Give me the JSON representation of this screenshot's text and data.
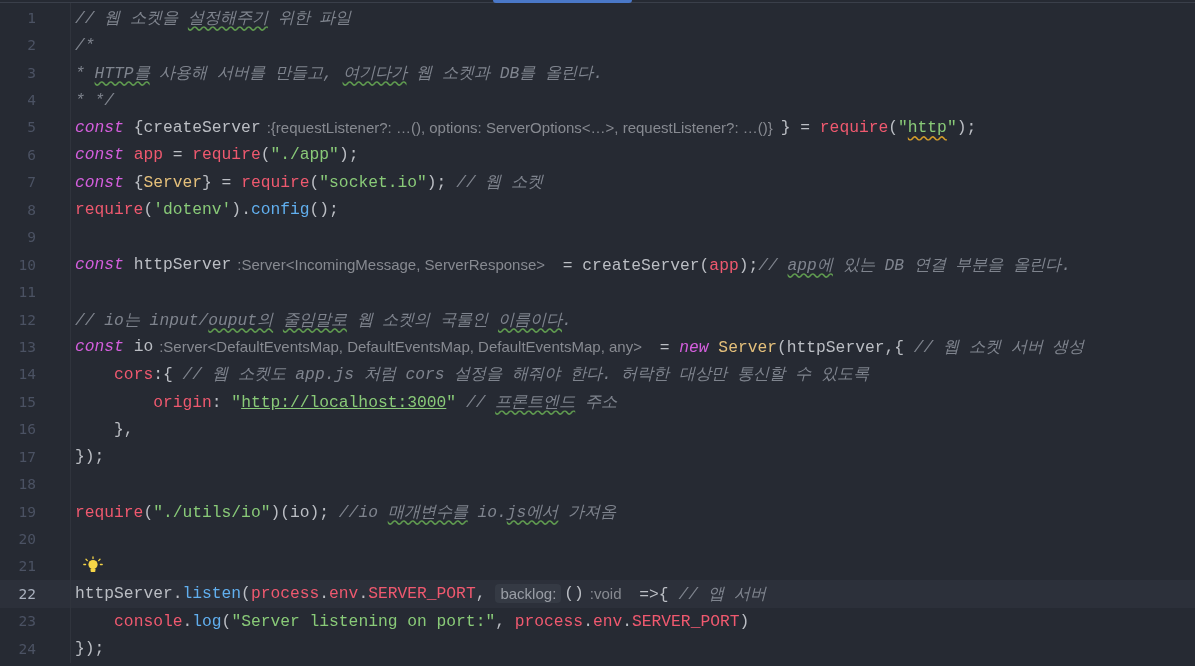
{
  "editor": {
    "lines": [
      {
        "number": "1",
        "current": false,
        "bulb": false,
        "tokens": [
          {
            "kind": "comment",
            "text": "// 웹 소켓을 "
          },
          {
            "kind": "comment-flagged",
            "text": "설정해주기"
          },
          {
            "kind": "comment",
            "text": " 위한 파일"
          }
        ]
      },
      {
        "number": "2",
        "current": false,
        "bulb": false,
        "tokens": [
          {
            "kind": "comment",
            "text": "/*"
          }
        ]
      },
      {
        "number": "3",
        "current": false,
        "bulb": false,
        "tokens": [
          {
            "kind": "comment",
            "text": "* "
          },
          {
            "kind": "comment-flagged",
            "text": "HTTP를"
          },
          {
            "kind": "comment",
            "text": " 사용해 서버를 만들고, "
          },
          {
            "kind": "comment-flagged",
            "text": "여기다가"
          },
          {
            "kind": "comment",
            "text": " 웹 소켓과 DB를 올린다."
          }
        ]
      },
      {
        "number": "4",
        "current": false,
        "bulb": false,
        "tokens": [
          {
            "kind": "comment",
            "text": "* */"
          }
        ]
      },
      {
        "number": "5",
        "current": false,
        "bulb": false,
        "tokens": [
          {
            "kind": "keyword",
            "text": "const"
          },
          {
            "kind": "plain",
            "text": " {createServer"
          },
          {
            "kind": "hint",
            "text": ":{requestListener?: …(), options: ServerOptions<…>, requestListener?: …()}"
          },
          {
            "kind": "plain",
            "text": "} = "
          },
          {
            "kind": "variable",
            "text": "require"
          },
          {
            "kind": "plain",
            "text": "("
          },
          {
            "kind": "string",
            "text": "\""
          },
          {
            "kind": "string-flagged",
            "text": "http"
          },
          {
            "kind": "string",
            "text": "\""
          },
          {
            "kind": "plain",
            "text": ");"
          }
        ]
      },
      {
        "number": "6",
        "current": false,
        "bulb": false,
        "tokens": [
          {
            "kind": "keyword",
            "text": "const"
          },
          {
            "kind": "variable",
            "text": " app"
          },
          {
            "kind": "plain",
            "text": " = "
          },
          {
            "kind": "variable",
            "text": "require"
          },
          {
            "kind": "plain",
            "text": "("
          },
          {
            "kind": "string",
            "text": "\"./app\""
          },
          {
            "kind": "plain",
            "text": ");"
          }
        ]
      },
      {
        "number": "7",
        "current": false,
        "bulb": false,
        "tokens": [
          {
            "kind": "keyword",
            "text": "const"
          },
          {
            "kind": "plain",
            "text": " {"
          },
          {
            "kind": "class",
            "text": "Server"
          },
          {
            "kind": "plain",
            "text": "} = "
          },
          {
            "kind": "variable",
            "text": "require"
          },
          {
            "kind": "plain",
            "text": "("
          },
          {
            "kind": "string",
            "text": "\"socket.io\""
          },
          {
            "kind": "plain",
            "text": "); "
          },
          {
            "kind": "comment",
            "text": "// 웹 소켓"
          }
        ]
      },
      {
        "number": "8",
        "current": false,
        "bulb": false,
        "tokens": [
          {
            "kind": "variable",
            "text": "require"
          },
          {
            "kind": "plain",
            "text": "("
          },
          {
            "kind": "string",
            "text": "'dotenv'"
          },
          {
            "kind": "plain",
            "text": ")."
          },
          {
            "kind": "function",
            "text": "config"
          },
          {
            "kind": "plain",
            "text": "();"
          }
        ]
      },
      {
        "number": "9",
        "current": false,
        "bulb": false
      },
      {
        "number": "10",
        "current": false,
        "bulb": false,
        "tokens": [
          {
            "kind": "keyword",
            "text": "const"
          },
          {
            "kind": "plain",
            "text": " httpServer"
          },
          {
            "kind": "hint",
            "text": ":Server<IncomingMessage, ServerResponse>"
          },
          {
            "kind": "plain",
            "text": " = createServer("
          },
          {
            "kind": "variable",
            "text": "app"
          },
          {
            "kind": "plain",
            "text": ");"
          },
          {
            "kind": "comment",
            "text": "// "
          },
          {
            "kind": "comment-flagged",
            "text": "app에"
          },
          {
            "kind": "comment",
            "text": " 있는 DB 연결 부분을 올린다."
          }
        ]
      },
      {
        "number": "11",
        "current": false,
        "bulb": false
      },
      {
        "number": "12",
        "current": false,
        "bulb": false,
        "tokens": [
          {
            "kind": "comment",
            "text": "// io는 input/"
          },
          {
            "kind": "comment-flagged",
            "text": "ouput의"
          },
          {
            "kind": "comment-flagged",
            "text": " 줄임말로"
          },
          {
            "kind": "comment",
            "text": " 웹 소켓의 국룰인 "
          },
          {
            "kind": "comment-flagged",
            "text": "이름이다"
          },
          {
            "kind": "comment",
            "text": "."
          }
        ]
      },
      {
        "number": "13",
        "current": false,
        "bulb": false,
        "tokens": [
          {
            "kind": "keyword",
            "text": "const"
          },
          {
            "kind": "plain",
            "text": " io"
          },
          {
            "kind": "hint",
            "text": ":Server<DefaultEventsMap, DefaultEventsMap, DefaultEventsMap, any>"
          },
          {
            "kind": "plain",
            "text": " = "
          },
          {
            "kind": "keyword",
            "text": "new "
          },
          {
            "kind": "class",
            "text": "Server"
          },
          {
            "kind": "plain",
            "text": "(httpServer,{ "
          },
          {
            "kind": "comment",
            "text": "// 웹 소켓 서버 생성"
          }
        ]
      },
      {
        "number": "14",
        "current": false,
        "bulb": false,
        "tokens": [
          {
            "kind": "variable",
            "text": "    cors"
          },
          {
            "kind": "plain",
            "text": ":{ "
          },
          {
            "kind": "comment",
            "text": "// 웹 소켓도 app.js 처럼 cors 설정을 해줘야 한다. 허락한 대상만 통신할 수 있도록"
          }
        ]
      },
      {
        "number": "15",
        "current": false,
        "bulb": false,
        "tokens": [
          {
            "kind": "variable",
            "text": "        origin"
          },
          {
            "kind": "plain",
            "text": ": "
          },
          {
            "kind": "string",
            "text": "\""
          },
          {
            "kind": "url",
            "text": "http://localhost:3000"
          },
          {
            "kind": "string",
            "text": "\""
          },
          {
            "kind": "comment",
            "text": " // "
          },
          {
            "kind": "comment-flagged",
            "text": "프론트엔드"
          },
          {
            "kind": "comment",
            "text": " 주소"
          }
        ]
      },
      {
        "number": "16",
        "current": false,
        "bulb": false,
        "tokens": [
          {
            "kind": "plain",
            "text": "    },"
          }
        ]
      },
      {
        "number": "17",
        "current": false,
        "bulb": false,
        "tokens": [
          {
            "kind": "plain",
            "text": "});"
          }
        ]
      },
      {
        "number": "18",
        "current": false,
        "bulb": false
      },
      {
        "number": "19",
        "current": false,
        "bulb": false,
        "tokens": [
          {
            "kind": "variable",
            "text": "require"
          },
          {
            "kind": "plain",
            "text": "("
          },
          {
            "kind": "string",
            "text": "\"./utils/io\""
          },
          {
            "kind": "plain",
            "text": ")(io); "
          },
          {
            "kind": "comment",
            "text": "//io "
          },
          {
            "kind": "comment-flagged",
            "text": "매개변수를"
          },
          {
            "kind": "comment",
            "text": " io."
          },
          {
            "kind": "comment-flagged",
            "text": "js에서"
          },
          {
            "kind": "comment",
            "text": " 가져옴"
          }
        ]
      },
      {
        "number": "20",
        "current": false,
        "bulb": false
      },
      {
        "number": "21",
        "current": false,
        "bulb": true
      },
      {
        "number": "22",
        "current": true,
        "bulb": false,
        "tokens": [
          {
            "kind": "plain",
            "text": "httpServer."
          },
          {
            "kind": "function",
            "text": "listen"
          },
          {
            "kind": "plain",
            "text": "("
          },
          {
            "kind": "variable",
            "text": "process"
          },
          {
            "kind": "plain",
            "text": "."
          },
          {
            "kind": "variable",
            "text": "env"
          },
          {
            "kind": "plain",
            "text": "."
          },
          {
            "kind": "variable",
            "text": "SERVER_PORT"
          },
          {
            "kind": "plain",
            "text": ","
          },
          {
            "kind": "param",
            "text": "backlog:"
          },
          {
            "kind": "plain",
            "text": "()"
          },
          {
            "kind": "hint",
            "text": ":void"
          },
          {
            "kind": "plain",
            "text": " =>{ "
          },
          {
            "kind": "comment",
            "text": "// 앱 서버"
          }
        ]
      },
      {
        "number": "23",
        "current": false,
        "bulb": false,
        "tokens": [
          {
            "kind": "variable",
            "text": "    console"
          },
          {
            "kind": "plain",
            "text": "."
          },
          {
            "kind": "function",
            "text": "log"
          },
          {
            "kind": "plain",
            "text": "("
          },
          {
            "kind": "string",
            "text": "\"Server listening on port:\""
          },
          {
            "kind": "plain",
            "text": ", "
          },
          {
            "kind": "variable",
            "text": "process"
          },
          {
            "kind": "plain",
            "text": "."
          },
          {
            "kind": "variable",
            "text": "env"
          },
          {
            "kind": "plain",
            "text": "."
          },
          {
            "kind": "variable",
            "text": "SERVER_PORT"
          },
          {
            "kind": "plain",
            "text": ")"
          }
        ]
      },
      {
        "number": "24",
        "current": false,
        "bulb": false,
        "tokens": [
          {
            "kind": "plain",
            "text": "});"
          }
        ]
      }
    ]
  }
}
